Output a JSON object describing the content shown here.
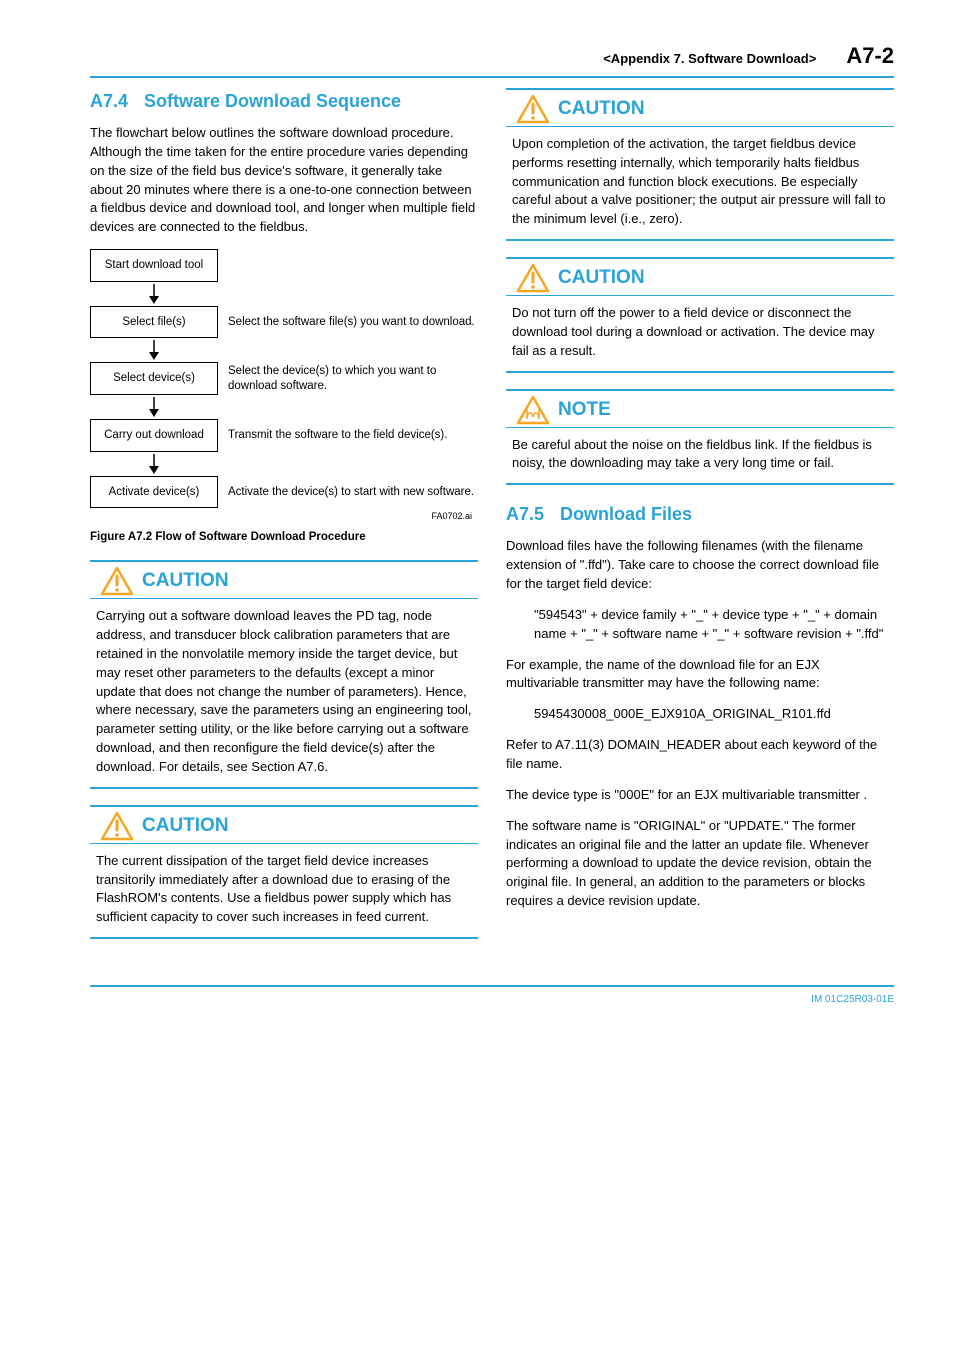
{
  "header": {
    "title": "<Appendix 7.  Software Download>",
    "page": "A7-2"
  },
  "left": {
    "sec1_num": "A7.4",
    "sec1_title": "Software Download Sequence",
    "intro": "The flowchart below outlines the software download procedure.  Although the time taken for the entire procedure varies depending on the size of the field bus device's software, it generally take about 20 minutes where there is a one-to-one connection between a fieldbus device and download tool, and longer when multiple field devices are connected to the fieldbus.",
    "flow": {
      "b1": "Start download tool",
      "b2": "Select file(s)",
      "d2": "Select the software file(s) you want to download.",
      "b3": "Select device(s)",
      "d3": "Select the device(s) to which you want to download software.",
      "b4": "Carry out download",
      "d4": "Transmit the software to the field device(s).",
      "b5": "Activate device(s)",
      "d5": "Activate the device(s) to start with new software.",
      "id": "FA0702.ai"
    },
    "fig_caption": "Figure A7.2    Flow of Software Download Procedure",
    "caution1_label": "CAUTION",
    "caution1_body": "Carrying out a software download leaves the PD tag, node address, and transducer block calibration parameters that are retained in the nonvolatile memory inside the target device, but may reset other parameters to the defaults (except a minor update that does not change the number of parameters).  Hence, where necessary, save the parameters using an engineering tool, parameter setting utility, or the like before carrying out a software download, and then reconfigure the field device(s) after the download.  For details, see Section A7.6.",
    "caution2_label": "CAUTION",
    "caution2_body": "The current dissipation of the target field device increases transitorily immediately after a download due to erasing of the FlashROM's contents.  Use a fieldbus power supply which has sufficient capacity to cover such increases in feed current."
  },
  "right": {
    "caution3_label": "CAUTION",
    "caution3_body": "Upon completion of the activation, the target fieldbus device performs resetting internally, which temporarily halts fieldbus communication and function block executions.  Be especially careful about a valve positioner; the output air pressure will fall to the minimum level (i.e., zero).",
    "caution4_label": "CAUTION",
    "caution4_body": "Do not turn off the power to a field device or disconnect the download tool during a download or activation.  The device may fail as a result.",
    "note_label": "NOTE",
    "note_body": "Be careful about the noise on the fieldbus link.  If the fieldbus is noisy, the downloading may take a very long time or fail.",
    "sec2_num": "A7.5",
    "sec2_title": "Download Files",
    "p1": "Download files have the following filenames (with the filename extension of \".ffd\").  Take care to choose the correct download file for the target field device:",
    "pattern": "\"594543\" + device family + \"_\" + device type + \"_\" + domain name + \"_\" + software name + \"_\" + software revision + \".ffd\"",
    "p2": "For example, the name of the download file for an EJX multivariable transmitter may have the following name:",
    "example": "5945430008_000E_EJX910A_ORIGINAL_R101.ffd",
    "p3": "Refer to A7.11(3) DOMAIN_HEADER about each keyword of the file name.",
    "p4": "The device type is \"000E\" for an EJX multivariable transmitter .",
    "p5": "The software name is \"ORIGINAL\" or \"UPDATE.\"  The former indicates an original file and the latter an update file.  Whenever performing a download to update the device revision, obtain the original file.  In general, an addition to the parameters or blocks requires a device revision update."
  },
  "footer": "IM 01C25R03-01E"
}
